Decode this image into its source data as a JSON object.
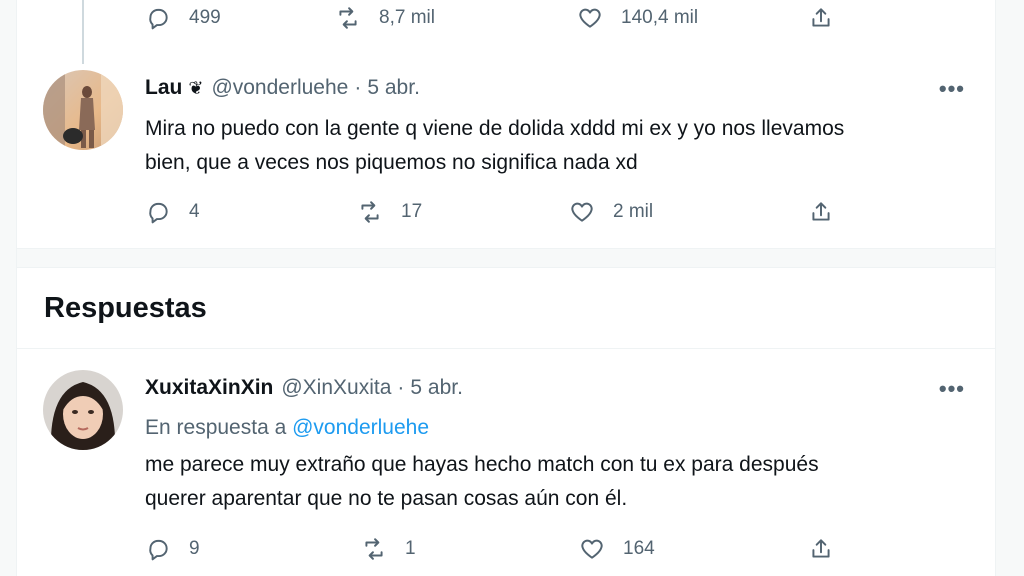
{
  "prev_tweet": {
    "actions": {
      "replies": "499",
      "retweets": "8,7 mil",
      "likes": "140,4 mil"
    }
  },
  "tweet": {
    "name": "Lau",
    "emoji": "❦",
    "handle": "@vonderluehe",
    "separator": "·",
    "date": "5 abr.",
    "more": "•••",
    "text_line1": "Mira no puedo con la gente q viene de dolida xddd mi ex y yo nos llevamos",
    "text_line2": "bien, que a veces nos piquemos no significa nada xd",
    "actions": {
      "replies": "4",
      "retweets": "17",
      "likes": "2 mil"
    }
  },
  "replies_section": {
    "title": "Respuestas"
  },
  "reply": {
    "name": "XuxitaXinXin",
    "handle": "@XinXuxita",
    "separator": "·",
    "date": "5 abr.",
    "more": "•••",
    "reply_prefix": "En respuesta a",
    "reply_mention": "@vonderluehe",
    "text_line1": "me parece muy extraño que hayas hecho match con tu ex para después",
    "text_line2": "querer aparentar que no te pasan cosas aún con él.",
    "actions": {
      "replies": "9",
      "retweets": "1",
      "likes": "164"
    }
  },
  "colors": {
    "accent": "#1d9bf0",
    "muted": "#536471",
    "text": "#0f1419"
  },
  "icons": [
    "reply-icon",
    "retweet-icon",
    "like-icon",
    "share-icon",
    "more-icon"
  ]
}
